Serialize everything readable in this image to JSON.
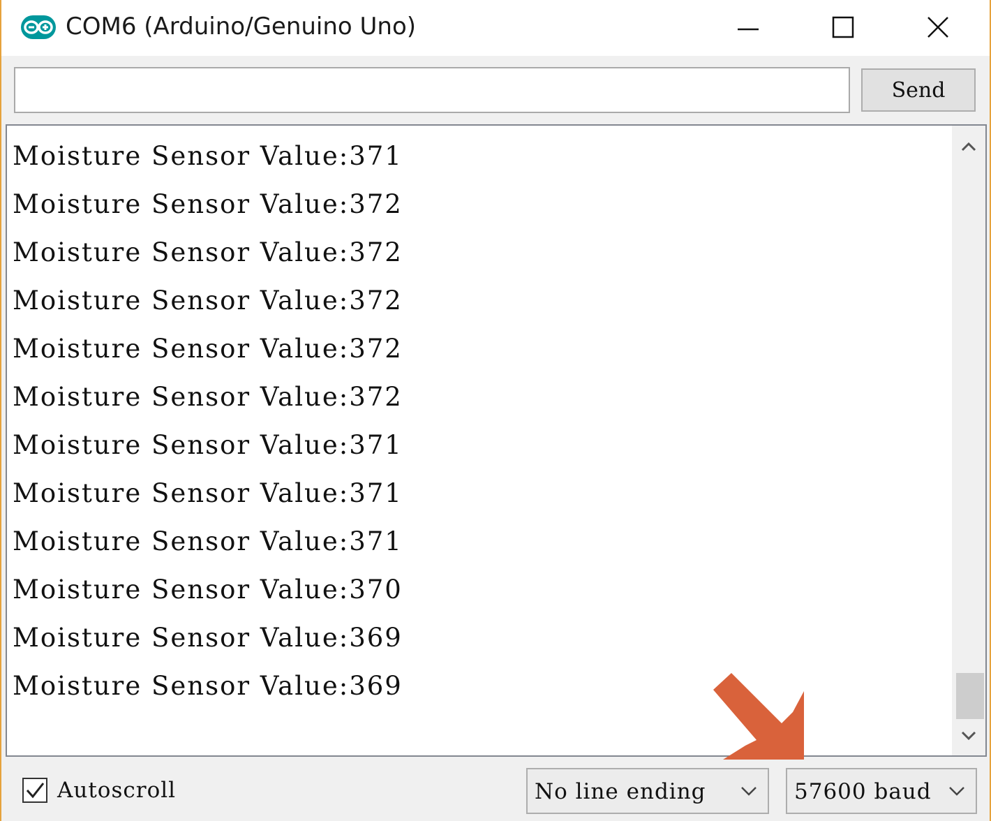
{
  "window": {
    "title": "COM6 (Arduino/Genuino Uno)",
    "app_icon": "arduino-logo-icon",
    "controls": [
      "minimize-icon",
      "maximize-icon",
      "close-icon"
    ],
    "frame_color": "#e6a23c"
  },
  "send_row": {
    "input_value": "",
    "send_label": "Send"
  },
  "output": {
    "lines": [
      "Moisture Sensor Value:371",
      "Moisture Sensor Value:372",
      "Moisture Sensor Value:372",
      "Moisture Sensor Value:372",
      "Moisture Sensor Value:372",
      "Moisture Sensor Value:372",
      "Moisture Sensor Value:371",
      "Moisture Sensor Value:371",
      "Moisture Sensor Value:371",
      "Moisture Sensor Value:370",
      "Moisture Sensor Value:369",
      "Moisture Sensor Value:369"
    ]
  },
  "bottom_bar": {
    "autoscroll_label": "Autoscroll",
    "autoscroll_checked": true,
    "line_ending": "No line ending",
    "baud_rate": "57600 baud"
  },
  "annotation": {
    "arrow_icon": "pointer-arrow-icon",
    "arrow_color": "#d9623b"
  }
}
